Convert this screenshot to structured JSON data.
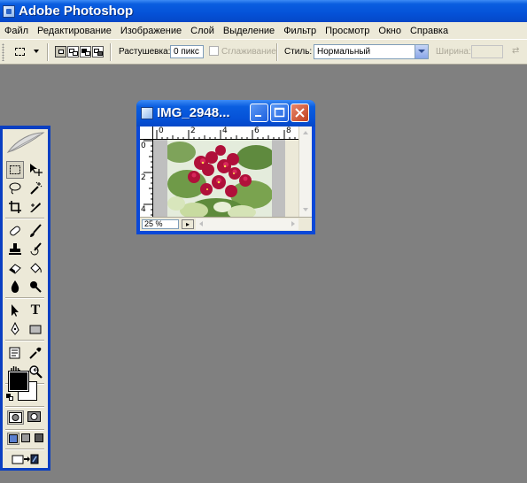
{
  "app": {
    "title": "Adobe Photoshop"
  },
  "menu": [
    "Файл",
    "Редактирование",
    "Изображение",
    "Слой",
    "Выделение",
    "Фильтр",
    "Просмотр",
    "Окно",
    "Справка"
  ],
  "options": {
    "feather_label": "Растушевка:",
    "feather_value": "0 пикс",
    "antialias_label": "Сглаживание",
    "style_label": "Стиль:",
    "style_value": "Нормальный",
    "width_label": "Ширина:"
  },
  "document": {
    "title": "IMG_2948...",
    "zoom": "25 %",
    "ruler_top": [
      "0",
      "2",
      "4",
      "6",
      "8"
    ],
    "ruler_left": [
      "0",
      "2",
      "4"
    ]
  },
  "colors": {
    "foreground": "#000000",
    "background": "#ffffff",
    "xp_blue": "#0a5ee0",
    "workspace": "#808080"
  },
  "icons": {
    "toolbox": [
      "rectangular-marquee-icon",
      "move-icon",
      "lasso-icon",
      "magic-wand-icon",
      "crop-icon",
      "slice-icon",
      "healing-brush-icon",
      "brush-icon",
      "clone-stamp-icon",
      "history-brush-icon",
      "eraser-icon",
      "paint-bucket-icon",
      "blur-icon",
      "dodge-icon",
      "path-selection-icon",
      "type-icon",
      "pen-icon",
      "rectangle-shape-icon",
      "notes-icon",
      "eyedropper-icon",
      "hand-icon",
      "zoom-icon"
    ]
  }
}
